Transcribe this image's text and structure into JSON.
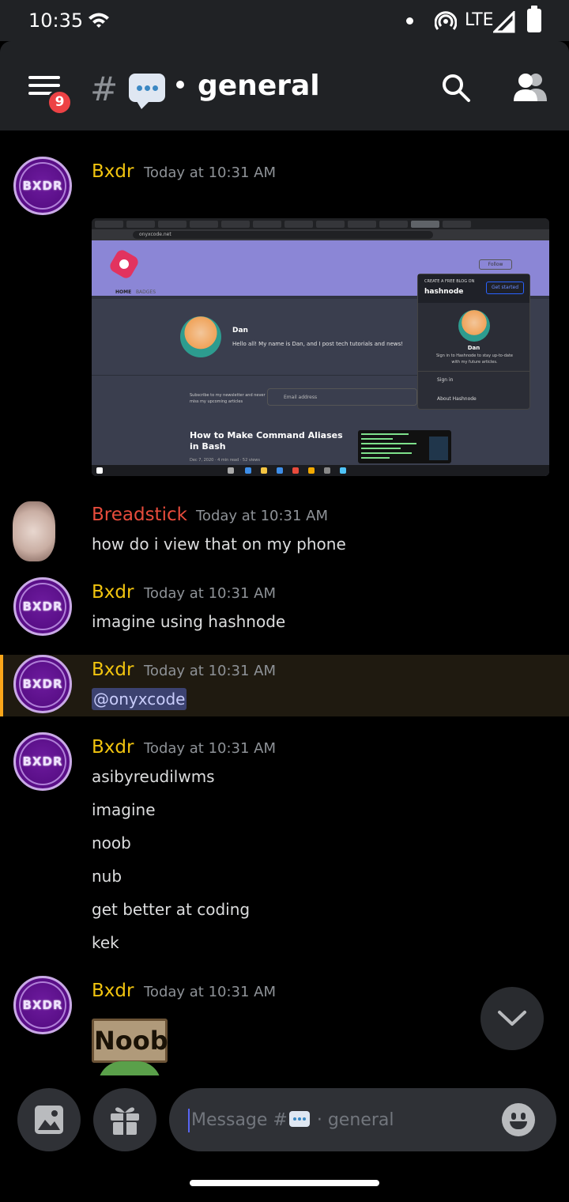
{
  "status_bar": {
    "time": "10:35",
    "network": "LTE"
  },
  "header": {
    "unread_count": "9",
    "hash": "#",
    "channel_name": "general"
  },
  "colors": {
    "author_gold": "#f1c40f",
    "author_red": "#e74c3c",
    "mention_highlight": "#faa61a",
    "background": "#000000",
    "header": "#202225"
  },
  "messages": [
    {
      "author": "Bxdr",
      "timestamp": "Today at 10:31 AM",
      "avatar_text": "BXDR",
      "attachment": {
        "url": "onyxcode.net",
        "nav_home": "HOME",
        "nav_badges": "BADGES",
        "follow": "Follow",
        "profile_name": "Dan",
        "profile_bio": "Hello all! My name is Dan, and I post tech tutorials and news!",
        "subscribe_text": "Subscribe to my newsletter and never miss my upcoming articles",
        "email_placeholder": "Email address",
        "article_title": "How to Make Command Aliases in Bash",
        "article_meta": "Dec 7, 2020 · 4 min read · 52 views",
        "dropdown_cta": "CREATE A FREE BLOG ON",
        "dropdown_brand": "hashnode",
        "dropdown_button": "Get started",
        "dropdown_name": "Dan",
        "dropdown_text": "Sign in to Hashnode to stay up-to-date with my future articles.",
        "dropdown_signin": "Sign in",
        "dropdown_about": "About Hashnode"
      }
    },
    {
      "author": "Breadstick",
      "timestamp": "Today at 10:31 AM",
      "text": "how do i view that on my phone"
    },
    {
      "author": "Bxdr",
      "timestamp": "Today at 10:31 AM",
      "avatar_text": "BXDR",
      "text": "imagine using hashnode"
    },
    {
      "author": "Bxdr",
      "timestamp": "Today at 10:31 AM",
      "avatar_text": "BXDR",
      "mention": "@onyxcode"
    },
    {
      "author": "Bxdr",
      "timestamp": "Today at 10:31 AM",
      "avatar_text": "BXDR",
      "lines": [
        "asibyreudilwms",
        "imagine",
        "noob",
        "nub",
        "get better at coding",
        "kek"
      ]
    },
    {
      "author": "Bxdr",
      "timestamp": "Today at 10:31 AM",
      "avatar_text": "BXDR",
      "sticker_text": "Noob"
    }
  ],
  "composer": {
    "placeholder_prefix": "Message #",
    "placeholder_suffix": "· general"
  },
  "icons": {
    "menu": "hamburger-icon",
    "search": "search-icon",
    "members": "members-icon",
    "image": "image-icon",
    "gift": "gift-icon",
    "emoji": "emoji-icon",
    "scroll": "chevron-down-icon"
  }
}
